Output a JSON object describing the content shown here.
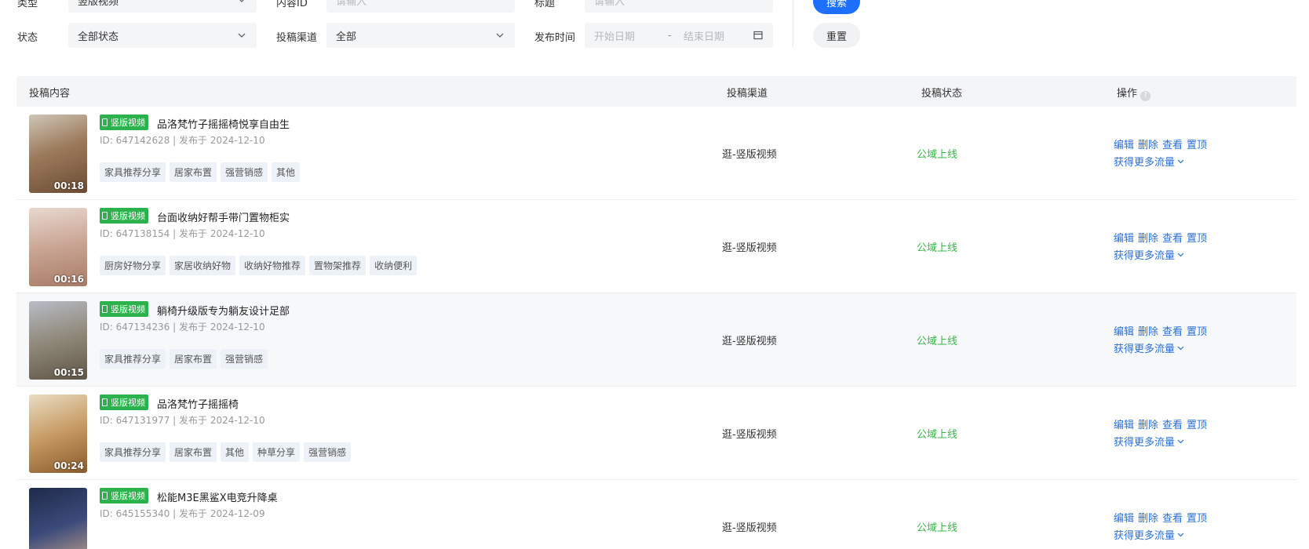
{
  "filters": {
    "type": {
      "label": "类型",
      "value": "竖版视频"
    },
    "content_id": {
      "label": "内容ID",
      "placeholder": "请输入"
    },
    "title": {
      "label": "标题",
      "placeholder": "请输入"
    },
    "status": {
      "label": "状态",
      "value": "全部状态"
    },
    "channel": {
      "label": "投稿渠道",
      "value": "全部"
    },
    "publish_time": {
      "label": "发布时间",
      "start_placeholder": "开始日期",
      "separator": "-",
      "end_placeholder": "结束日期"
    },
    "search_label": "搜索",
    "reset_label": "重置"
  },
  "table": {
    "headers": {
      "content": "投稿内容",
      "channel": "投稿渠道",
      "status": "投稿状态",
      "ops": "操作"
    },
    "help_glyph": "?",
    "video_tag": "竖版视频",
    "op_labels": {
      "edit": "编辑",
      "delete": "删除",
      "view": "查看",
      "pin": "置顶",
      "traffic": "获得更多流量"
    },
    "rows": [
      {
        "title": "品洛梵竹子摇摇椅悦享自由生",
        "meta": "ID: 647142628 | 发布于 2024-12-10",
        "duration": "00:18",
        "tags": [
          "家具推荐分享",
          "居家布置",
          "强营销感",
          "其他"
        ],
        "channel": "逛-竖版视频",
        "status": "公域上线"
      },
      {
        "title": "台面收纳好帮手带门置物柜实",
        "meta": "ID: 647138154 | 发布于 2024-12-10",
        "duration": "00:16",
        "tags": [
          "厨房好物分享",
          "家居收纳好物",
          "收纳好物推荐",
          "置物架推荐",
          "收纳便利"
        ],
        "channel": "逛-竖版视频",
        "status": "公域上线"
      },
      {
        "title": "躺椅升级版专为躺友设计足部",
        "meta": "ID: 647134236 | 发布于 2024-12-10",
        "duration": "00:15",
        "tags": [
          "家具推荐分享",
          "居家布置",
          "强营销感"
        ],
        "channel": "逛-竖版视频",
        "status": "公域上线"
      },
      {
        "title": "品洛梵竹子摇摇椅",
        "meta": "ID: 647131977 | 发布于 2024-12-10",
        "duration": "00:24",
        "tags": [
          "家具推荐分享",
          "居家布置",
          "其他",
          "种草分享",
          "强营销感"
        ],
        "channel": "逛-竖版视频",
        "status": "公域上线"
      },
      {
        "title": "松能M3E黑鲨X电竞升降桌",
        "meta": "ID: 645155340 | 发布于 2024-12-09",
        "duration": "",
        "tags": [],
        "channel": "逛-竖版视频",
        "status": "公域上线"
      }
    ]
  },
  "colors": {
    "primary": "#1f6fff",
    "tag_green": "#2bb24c",
    "status_green": "#3ab54a",
    "link_blue": "#2b6fd6"
  }
}
